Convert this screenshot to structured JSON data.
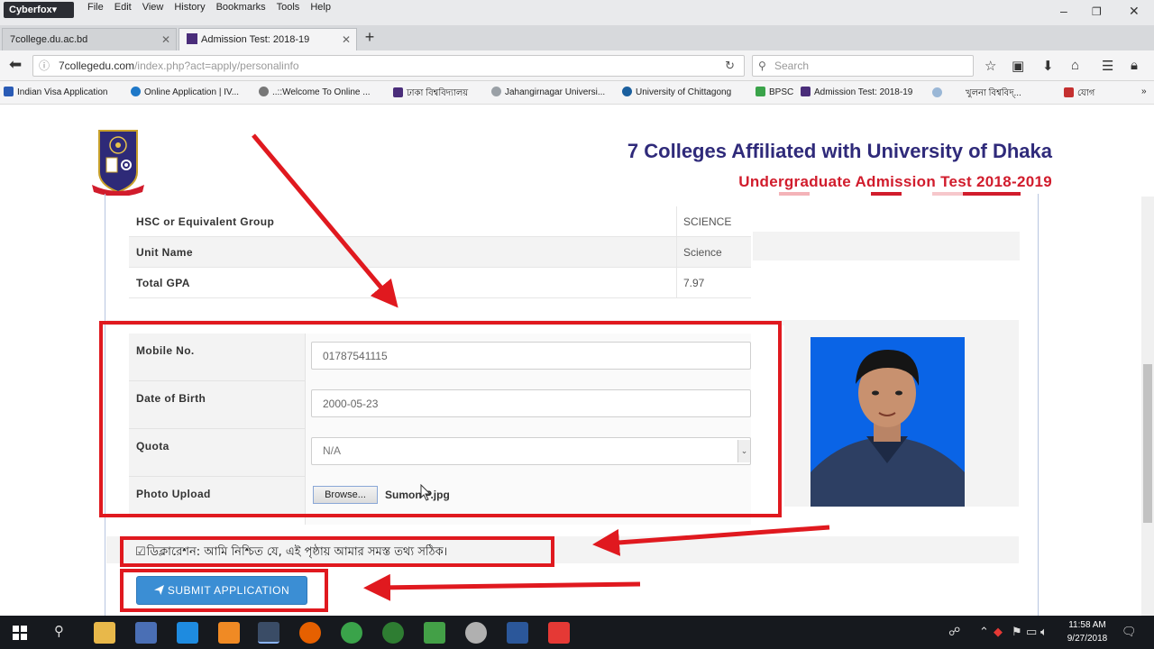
{
  "browser": {
    "brand": "Cyberfox▾",
    "menu": [
      "File",
      "Edit",
      "View",
      "History",
      "Bookmarks",
      "Tools",
      "Help"
    ],
    "tabs": [
      {
        "title": "7college.du.ac.bd"
      },
      {
        "title": "Admission Test: 2018-19"
      }
    ],
    "url_domain": "7collegedu.com",
    "url_path": "/index.php?act=apply/personalinfo",
    "search_placeholder": "Search",
    "bookmarks": [
      {
        "label": "Indian Visa Application",
        "color": "#2a5bb5"
      },
      {
        "label": "Online Application | IV...",
        "color": "#1e78c8"
      },
      {
        "label": "..::Welcome To Online ...",
        "color": "#777777"
      },
      {
        "label": "ঢাকা বিশ্ববিদ্যালয়",
        "color": "#4a2d7a"
      },
      {
        "label": "Jahangirnagar Universi...",
        "color": "#9aa0a6"
      },
      {
        "label": "University of Chittagong",
        "color": "#1a5f9e"
      },
      {
        "label": "BPSC",
        "color": "#3aa34a"
      },
      {
        "label": "Admission Test: 2018-19",
        "color": "#4a2d7a"
      },
      {
        "label": "খুলনা বিশ্ববিদ্...",
        "color": "#9ab7d6"
      },
      {
        "label": "যোগ",
        "color": "#c43030"
      }
    ]
  },
  "header": {
    "title": "7 Colleges Affiliated with University of Dhaka",
    "subtitle": "Undergraduate Admission Test 2018-2019",
    "title_color": "#2f2a7a",
    "subtitle_color": "#d11c2c"
  },
  "info_rows": [
    {
      "label": "HSC or Equivalent Group",
      "value": "SCIENCE"
    },
    {
      "label": "Unit Name",
      "value": "Science"
    },
    {
      "label": "Total GPA",
      "value": "7.97"
    }
  ],
  "form": {
    "mobile": {
      "label": "Mobile No.",
      "value": "01787541115"
    },
    "dob": {
      "label": "Date of Birth",
      "value": "2000-05-23"
    },
    "quota": {
      "label": "Quota",
      "value": "N/A"
    },
    "photo": {
      "label": "Photo Upload",
      "browse_label": "Browse...",
      "file_name": "Sumon P.jpg"
    }
  },
  "declaration": {
    "checkbox_symbol": "☑",
    "text": "ডিক্লারেশন: আমি নিশ্চিত যে, এই পৃষ্ঠায় আমার সমস্ত তথ্য সঠিক।"
  },
  "submit": {
    "label": "SUBMIT APPLICATION"
  },
  "annotation_color": "#e0191f",
  "taskbar": {
    "clock_time": "11:58 AM",
    "clock_date": "9/27/2018"
  }
}
